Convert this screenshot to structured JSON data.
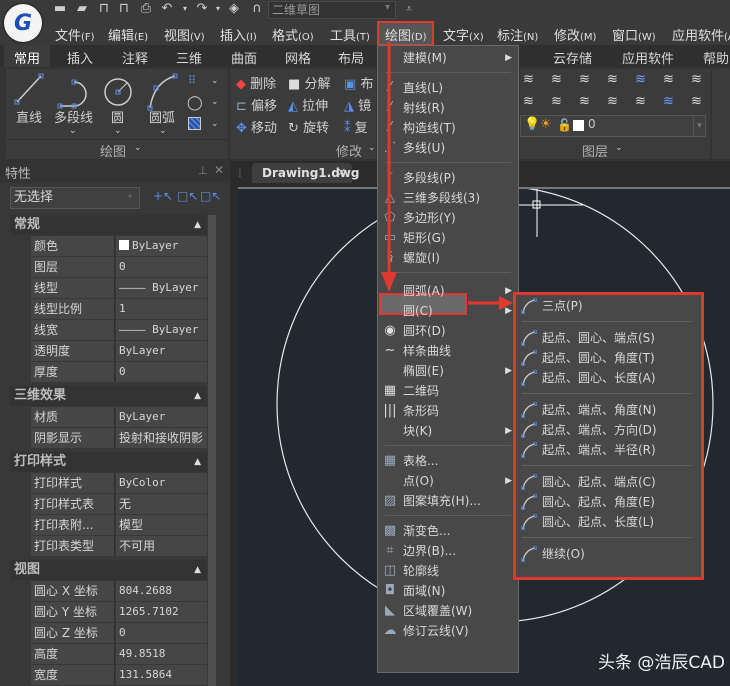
{
  "app": {
    "logo_letter": "G",
    "workspace": "二维草图"
  },
  "quick_access": [
    "new-file-icon",
    "open-folder-icon",
    "save-icon",
    "save-as-icon",
    "print-icon",
    "undo-icon",
    "redo-icon",
    "layers-icon",
    "headset-icon"
  ],
  "menubar": [
    {
      "label": "文件",
      "acc": "(F)"
    },
    {
      "label": "编辑",
      "acc": "(E)"
    },
    {
      "label": "视图",
      "acc": "(V)"
    },
    {
      "label": "插入",
      "acc": "(I)"
    },
    {
      "label": "格式",
      "acc": "(O)"
    },
    {
      "label": "工具",
      "acc": "(T)"
    },
    {
      "label": "绘图",
      "acc": "(D)"
    },
    {
      "label": "文字",
      "acc": "(X)"
    },
    {
      "label": "标注",
      "acc": "(N)"
    },
    {
      "label": "修改",
      "acc": "(M)"
    },
    {
      "label": "窗口",
      "acc": "(W)"
    },
    {
      "label": "应用软件",
      "acc": "(A)"
    }
  ],
  "ribbon_tabs": [
    "常用",
    "插入",
    "注释",
    "三维",
    "曲面",
    "网格",
    "布局",
    "云存储",
    "应用软件",
    "帮助"
  ],
  "ribbon": {
    "draw_panel": {
      "title": "绘图",
      "big_tools": [
        "直线",
        "多段线",
        "圆",
        "圆弧"
      ]
    },
    "modify_panel": {
      "title": "修改",
      "tools": [
        "删除",
        "分解",
        "布",
        "偏移",
        "拉伸",
        "镜",
        "移动",
        "旋转",
        "复"
      ]
    },
    "layer_panel": {
      "title": "图层",
      "current_layer": "0"
    }
  },
  "properties": {
    "title": "特性",
    "selection": "无选择",
    "sections": [
      {
        "title": "常规",
        "rows": [
          {
            "key": "颜色",
            "value": "ByLayer"
          },
          {
            "key": "图层",
            "value": "0"
          },
          {
            "key": "线型",
            "value": "———— ByLayer"
          },
          {
            "key": "线型比例",
            "value": "1"
          },
          {
            "key": "线宽",
            "value": "———— ByLayer"
          },
          {
            "key": "透明度",
            "value": "ByLayer"
          },
          {
            "key": "厚度",
            "value": "0"
          }
        ]
      },
      {
        "title": "三维效果",
        "rows": [
          {
            "key": "材质",
            "value": "ByLayer"
          },
          {
            "key": "阴影显示",
            "value": "投射和接收阴影"
          }
        ]
      },
      {
        "title": "打印样式",
        "rows": [
          {
            "key": "打印样式",
            "value": "ByColor"
          },
          {
            "key": "打印样式表",
            "value": "无"
          },
          {
            "key": "打印表附...",
            "value": "模型"
          },
          {
            "key": "打印表类型",
            "value": "不可用"
          }
        ]
      },
      {
        "title": "视图",
        "rows": [
          {
            "key": "圆心 X 坐标",
            "value": "804.2688"
          },
          {
            "key": "圆心 Y 坐标",
            "value": "1265.7102"
          },
          {
            "key": "圆心 Z 坐标",
            "value": "0"
          },
          {
            "key": "高度",
            "value": "49.8518"
          },
          {
            "key": "宽度",
            "value": "131.5864"
          }
        ]
      }
    ]
  },
  "document_tab": "Drawing1.dwg",
  "draw_menu": [
    {
      "label": "建模(M)",
      "icon": "",
      "sub": true
    },
    {
      "sep": true
    },
    {
      "label": "直线(L)",
      "icon": "line-icon"
    },
    {
      "label": "射线(R)",
      "icon": "ray-icon"
    },
    {
      "label": "构造线(T)",
      "icon": "xline-icon"
    },
    {
      "label": "多线(U)",
      "icon": "mline-icon"
    },
    {
      "sep": true
    },
    {
      "label": "多段线(P)",
      "icon": "polyline-icon"
    },
    {
      "label": "三维多段线(3)",
      "icon": "3d-polyline-icon"
    },
    {
      "label": "多边形(Y)",
      "icon": "polygon-icon"
    },
    {
      "label": "矩形(G)",
      "icon": "rectangle-icon"
    },
    {
      "label": "螺旋(I)",
      "icon": "helix-icon"
    },
    {
      "sep": true
    },
    {
      "label": "圆弧(A)",
      "icon": "",
      "sub": true,
      "highlighted": true
    },
    {
      "label": "圆(C)",
      "icon": "",
      "sub": true
    },
    {
      "label": "圆环(D)",
      "icon": "donut-icon"
    },
    {
      "label": "样条曲线",
      "icon": "spline-icon"
    },
    {
      "label": "椭圆(E)",
      "icon": "",
      "sub": true
    },
    {
      "label": "二维码",
      "icon": "qrcode-icon"
    },
    {
      "label": "条形码",
      "icon": "barcode-icon"
    },
    {
      "label": "块(K)",
      "icon": "",
      "sub": true
    },
    {
      "sep": true
    },
    {
      "label": "表格...",
      "icon": "table-icon"
    },
    {
      "label": "点(O)",
      "icon": "",
      "sub": true
    },
    {
      "label": "图案填充(H)...",
      "icon": "hatch-icon"
    },
    {
      "sep": true
    },
    {
      "label": "渐变色...",
      "icon": "gradient-icon"
    },
    {
      "label": "边界(B)...",
      "icon": "boundary-icon"
    },
    {
      "label": "轮廓线",
      "icon": "outline-icon"
    },
    {
      "label": "面域(N)",
      "icon": "region-icon"
    },
    {
      "label": "区域覆盖(W)",
      "icon": "wipeout-icon"
    },
    {
      "label": "修订云线(V)",
      "icon": "revcloud-icon"
    }
  ],
  "arc_menu": [
    {
      "label": "三点(P)"
    },
    {
      "sep": true
    },
    {
      "label": "起点、圆心、端点(S)"
    },
    {
      "label": "起点、圆心、角度(T)"
    },
    {
      "label": "起点、圆心、长度(A)"
    },
    {
      "sep": true
    },
    {
      "label": "起点、端点、角度(N)"
    },
    {
      "label": "起点、端点、方向(D)"
    },
    {
      "label": "起点、端点、半径(R)"
    },
    {
      "sep": true
    },
    {
      "label": "圆心、起点、端点(C)"
    },
    {
      "label": "圆心、起点、角度(E)"
    },
    {
      "label": "圆心、起点、长度(L)"
    },
    {
      "sep": true
    },
    {
      "label": "继续(O)"
    }
  ],
  "colors": {
    "highlight_red": "#e03a2e",
    "accent_blue": "#4f7fd6",
    "canvas_bg": "#212830"
  },
  "watermark": "头条 @浩辰CAD"
}
